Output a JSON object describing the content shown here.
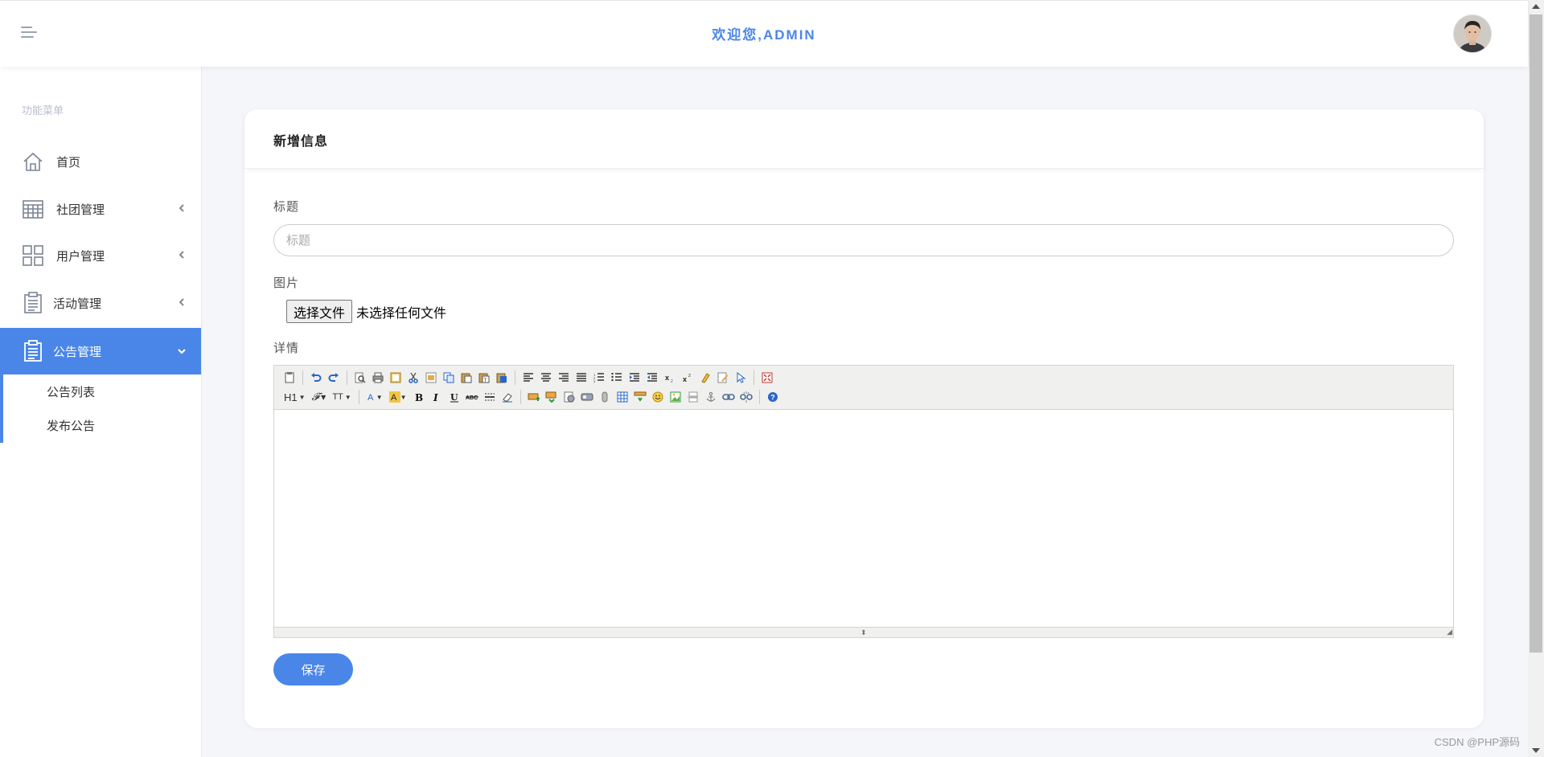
{
  "header": {
    "title": "欢迎您,ADMIN",
    "accent": "#4a86e8"
  },
  "sidebar": {
    "caption": "功能菜单",
    "items": [
      {
        "label": "首页",
        "icon": "home-icon"
      },
      {
        "label": "社团管理",
        "icon": "calendar-grid-icon"
      },
      {
        "label": "用户管理",
        "icon": "grid-icon"
      },
      {
        "label": "活动管理",
        "icon": "clipboard-icon"
      },
      {
        "label": "公告管理",
        "icon": "clipboard-icon",
        "active": true
      }
    ],
    "subitems": [
      "公告列表",
      "发布公告"
    ]
  },
  "form": {
    "title": "新增信息",
    "title_label": "标题",
    "title_placeholder": "标题",
    "image_label": "图片",
    "file_button": "选择文件",
    "file_status": "未选择任何文件",
    "detail_label": "详情",
    "save_label": "保存"
  },
  "editor": {
    "heading_button": "H1",
    "font_family_button": "𝓕",
    "font_size_button": "TT"
  },
  "watermark": "CSDN @PHP源码"
}
